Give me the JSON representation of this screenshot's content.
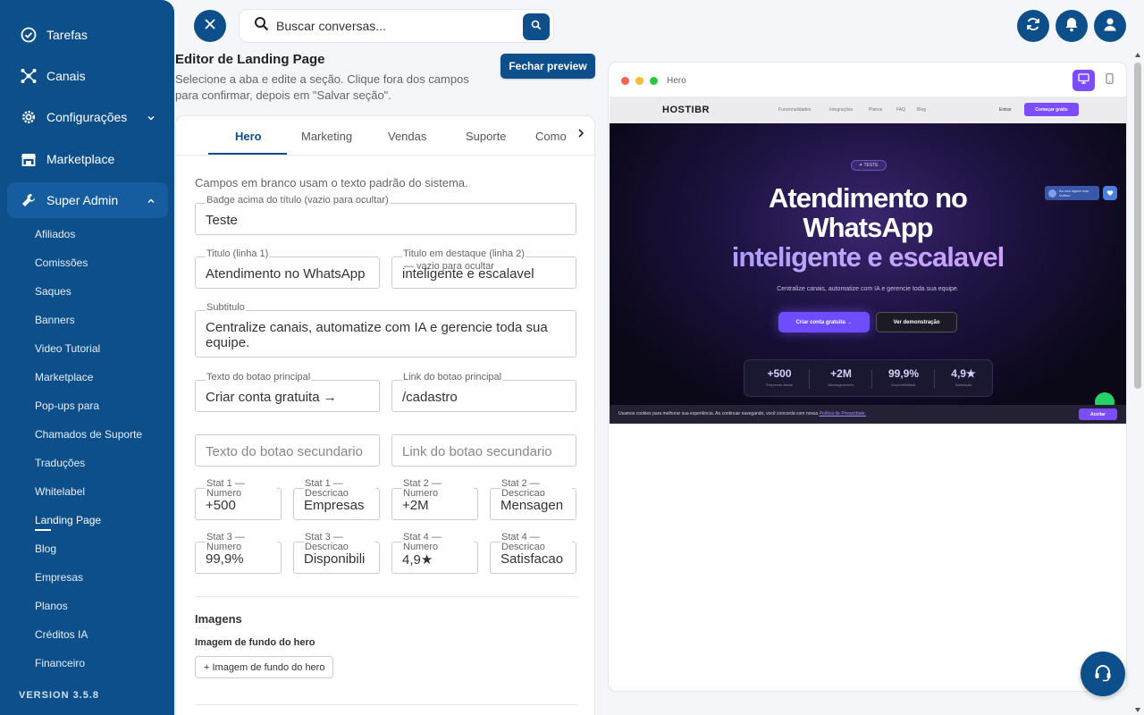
{
  "sidebar": {
    "items": [
      {
        "label": "Tarefas",
        "icon": "check-circle-icon"
      },
      {
        "label": "Canais",
        "icon": "network-icon"
      },
      {
        "label": "Configurações",
        "icon": "gear-icon"
      },
      {
        "label": "Marketplace",
        "icon": "store-icon"
      },
      {
        "label": "Super Admin",
        "icon": "wrench-icon"
      }
    ],
    "sub_items": [
      "Afiliados",
      "Comissões",
      "Saques",
      "Banners",
      "Video Tutorial",
      "Marketplace",
      "Pop-ups para",
      "Chamados de Suporte",
      "Traduções",
      "Whitelabel",
      "Landing Page",
      "Blog",
      "Empresas",
      "Planos",
      "Créditos IA",
      "Financeiro"
    ],
    "current_sub": "Landing Page",
    "version": "VERSION 3.5.8"
  },
  "topbar": {
    "search_placeholder": "Buscar conversas..."
  },
  "editor": {
    "title": "Editor de Landing Page",
    "description": "Selecione a aba e edite a seção. Clique fora dos campos para confirmar, depois em \"Salvar seção\".",
    "close_preview": "Fechar preview",
    "tabs": [
      "Hero",
      "Marketing",
      "Vendas",
      "Suporte",
      "Como"
    ],
    "active_tab": "Hero",
    "hint": "Campos em branco usam o texto padrão do sistema.",
    "fields": {
      "badge": {
        "label": "Badge acima do título (vazio para ocultar)",
        "value": "Teste"
      },
      "title1": {
        "label": "Titulo (linha 1)",
        "value": "Atendimento no WhatsApp"
      },
      "title2": {
        "label": "Titulo em destaque (linha 2)",
        "overlay": "— vazio para ocultar",
        "value": "inteligente e escalavel"
      },
      "subtitle": {
        "label": "Subtitulo",
        "value": "Centralize canais, automatize com IA e gerencie toda sua equipe."
      },
      "btn_primary_text": {
        "label": "Texto do botao principal",
        "value": "Criar conta gratuita →"
      },
      "btn_primary_link": {
        "label": "Link do botao principal",
        "value": "/cadastro"
      },
      "btn_secondary_text": {
        "placeholder": "Texto do botao secundario"
      },
      "btn_secondary_link": {
        "placeholder": "Link do botao secundario"
      },
      "stats": [
        {
          "label": "Stat 1 — Numero",
          "value": "+500"
        },
        {
          "label": "Stat 1 — Descricao",
          "value": "Empresas"
        },
        {
          "label": "Stat 2 — Numero",
          "value": "+2M"
        },
        {
          "label": "Stat 2 — Descricao",
          "value": "Mensagen"
        },
        {
          "label": "Stat 3 — Numero",
          "value": "99,9%"
        },
        {
          "label": "Stat 3 — Descricao",
          "value": "Disponibili"
        },
        {
          "label": "Stat 4 — Numero",
          "value": "4,9★"
        },
        {
          "label": "Stat 4 — Descricao",
          "value": "Satisfacao"
        }
      ]
    },
    "images_title": "Imagens",
    "hero_bg_label": "Imagem de fundo do hero",
    "hero_bg_button": "+ Imagem de fundo do hero"
  },
  "preview": {
    "window_title": "Hero",
    "site": {
      "logo": "HOSTIBR",
      "nav": [
        "Funcionalidades",
        "Integrações",
        "Planos",
        "FAQ",
        "Blog"
      ],
      "enter": "Entrar",
      "cta": "Começar grátis",
      "badge": "✦ TESTE",
      "headline1": "Atendimento no",
      "headline2": "WhatsApp",
      "headline3": "inteligente e escalavel",
      "subtitle": "Centralize canais, automatize com IA e gerencie toda sua equipe.",
      "btn_primary": "Criar conta gratuita →",
      "btn_secondary": "Ver demonstração",
      "stats": [
        {
          "num": "+500",
          "label": "Empresas ativas"
        },
        {
          "num": "+2M",
          "label": "Mensagens/mês"
        },
        {
          "num": "99,9%",
          "label": "Disponibilidade"
        },
        {
          "num": "4,9★",
          "label": "Satisfação"
        }
      ],
      "online_line1": "Ao vivo agora com",
      "online_line2": "Vultrou",
      "cookie_text": "Usamos cookies para melhorar sua experiência. Ao continuar navegando, você concorda com nossa ",
      "cookie_link": "Política de Privacidade.",
      "accept": "Aceitar"
    }
  },
  "colors": {
    "primary": "#0d4f8b",
    "accent": "#7c4dff"
  }
}
